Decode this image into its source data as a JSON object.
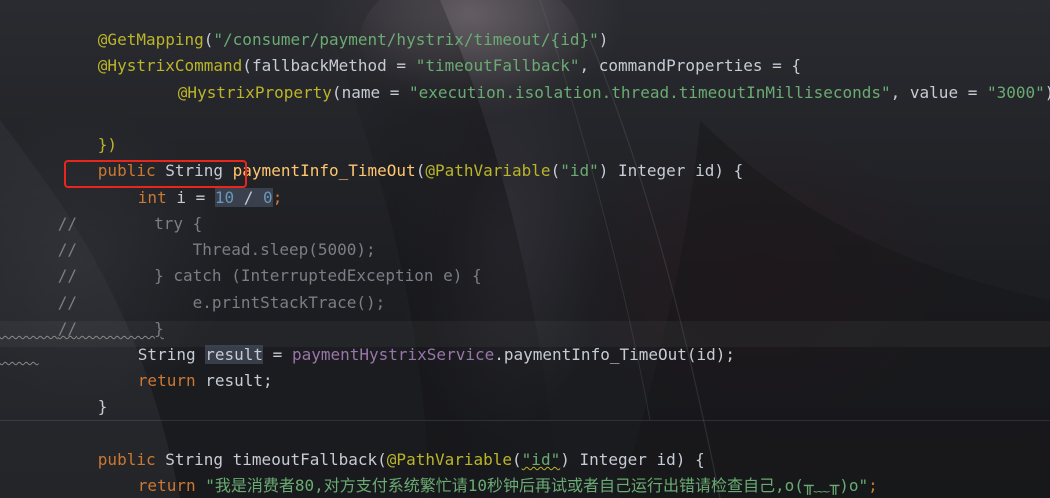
{
  "editor": {
    "theme_colors": {
      "annotation": "#bbb529",
      "string": "#6aab73",
      "keyword": "#cc7832",
      "method_declaration": "#ffc66d",
      "field": "#9876aa",
      "number": "#6897bb",
      "comment": "#7a7e85",
      "highlight_box": "#e8261c"
    },
    "lines": {
      "l1": {
        "ann": "@GetMapping",
        "p1": "(",
        "s1": "\"/consumer/payment/hystrix/timeout/{id}\"",
        "p2": ")"
      },
      "l2": {
        "ann": "@HystrixCommand",
        "p1": "(",
        "attr1": "fallbackMethod",
        "eq1": " = ",
        "s1": "\"timeoutFallback\"",
        "c1": ", ",
        "attr2": "commandProperties",
        "eq2": " = {"
      },
      "l3": {
        "ann": "@HystrixProperty",
        "p1": "(",
        "attr1": "name",
        "eq1": " = ",
        "s1": "\"execution.isolation.thread.timeoutInMilliseconds\"",
        "c1": ", ",
        "attr2": "value",
        "eq2": " = ",
        "s2": "\"3000\"",
        "p2": ")"
      },
      "l4": {
        "text": "})"
      },
      "l5": {
        "kw": "public",
        "type": " String ",
        "fn": "paymentInfo_TimeOut",
        "p1": "(",
        "ann": "@PathVariable",
        "p2": "(",
        "s1": "\"id\"",
        "p3": ")",
        "rest": " Integer id) {"
      },
      "l6": {
        "kw": "int",
        "var": " i = ",
        "n1": "10",
        "op": " / ",
        "n2": "0",
        "end": ";"
      },
      "l7": {
        "cm": "//",
        "code": "        try {"
      },
      "l8": {
        "cm": "//",
        "code": "            Thread.sleep(5000);"
      },
      "l9": {
        "cm": "//",
        "code": "        } catch (InterruptedException e) {"
      },
      "l10": {
        "cm": "//",
        "code": "            e.printStackTrace();"
      },
      "l11": {
        "cm": "//",
        "code": "        }"
      },
      "l12": {
        "type": "String ",
        "var": "result",
        "eq": " = ",
        "field": "paymentHystrixService",
        "call": ".paymentInfo_TimeOut(id);"
      },
      "l13": {
        "kw": "return",
        "rest": " result;"
      },
      "l14": {
        "text": "}"
      },
      "l15": {
        "kw": "public",
        "type": " String ",
        "fn": "timeoutFallback",
        "p1": "(",
        "ann": "@PathVariable",
        "p2": "(",
        "s1": "\"id\"",
        "p3": ")",
        "rest": " Integer id) {"
      },
      "l16": {
        "kw": "return",
        "sp": " ",
        "s1": "\"我是消费者80,对方支付系统繁忙请10秒钟后再试或者自己运行出错请检查自己,o(╥﹏╥)o\"",
        "end": ";"
      },
      "l17": {
        "text": "}"
      }
    }
  }
}
